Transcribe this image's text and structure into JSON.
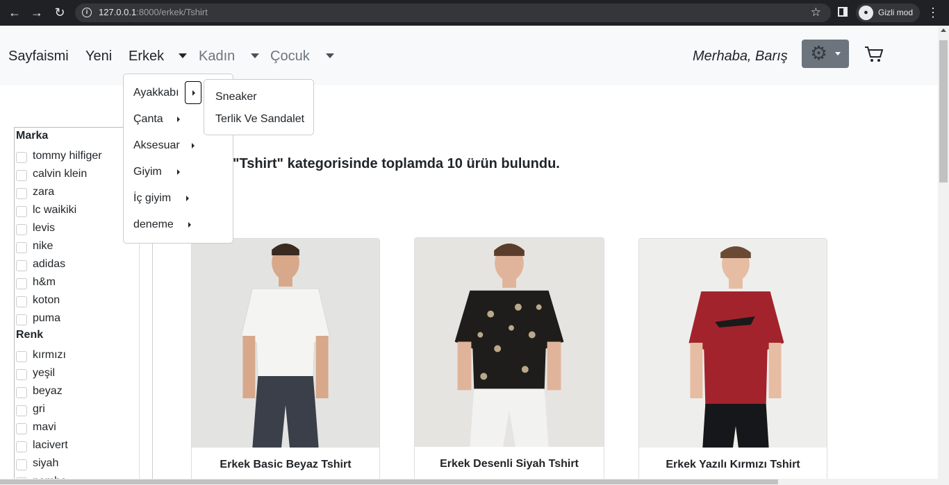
{
  "browser": {
    "url_host": "127.0.0.1",
    "url_path": ":8000/erkek/Tshirt",
    "incognito_label": "Gizli mod"
  },
  "navbar": {
    "brand": "Sayfaismi",
    "links": [
      "Yeni",
      "Erkek",
      "Kadın",
      "Çocuk"
    ],
    "greeting": "Merhaba, Barış"
  },
  "dropdown": {
    "items": [
      "Ayakkabı",
      "Çanta",
      "Aksesuar",
      "Giyim",
      "İç giyim",
      "deneme"
    ],
    "submenu": [
      "Sneaker",
      "Terlik Ve Sandalet"
    ]
  },
  "sidebar": {
    "brand_heading": "Marka",
    "brands": [
      "tommy hilfiger",
      "calvin klein",
      "zara",
      "lc waikiki",
      "levis",
      "nike",
      "adidas",
      "h&m",
      "koton",
      "puma"
    ],
    "color_heading": "Renk",
    "colors": [
      "kırmızı",
      "yeşil",
      "beyaz",
      "gri",
      "mavi",
      "lacivert",
      "siyah",
      "pembe"
    ]
  },
  "results_text": "\"Tshirt\" kategorisinde toplamda 10 ürün bulundu.",
  "products": [
    {
      "title": "Erkek Basic Beyaz Tshirt",
      "shirt_color": "#f4f4f2",
      "pants_color": "#3a3f4a"
    },
    {
      "title": "Erkek Desenli Siyah Tshirt",
      "shirt_color": "#1e1d1b",
      "pants_color": "#f2f2f0"
    },
    {
      "title": "Erkek Yazılı Kırmızı Tshirt",
      "shirt_color": "#a3232c",
      "pants_color": "#16171a"
    }
  ],
  "colors": {
    "navbar_bg": "#f8f9fa",
    "settings_btn": "#6c757d",
    "chrome_bg": "#202124"
  }
}
